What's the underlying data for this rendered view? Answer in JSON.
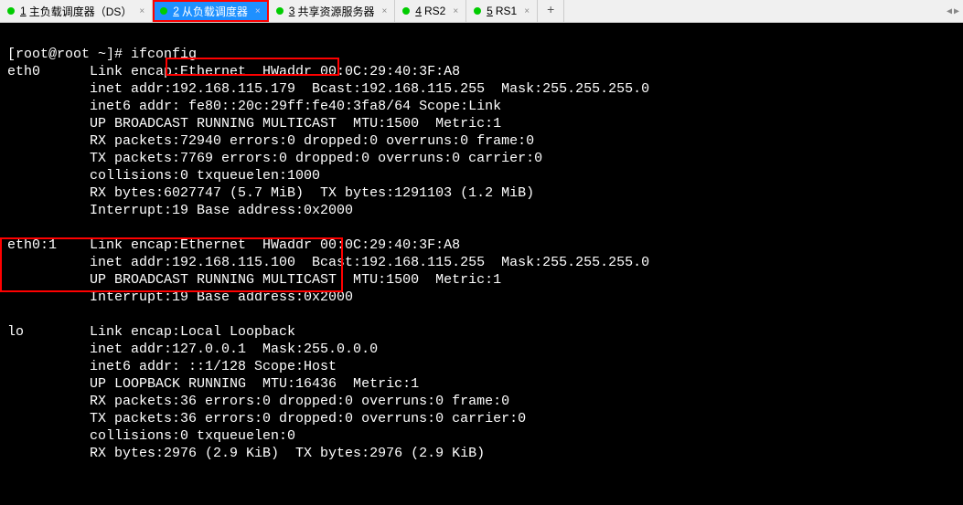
{
  "tabs": [
    {
      "num": "1",
      "label": "主负载调度器（DS）",
      "active": false
    },
    {
      "num": "2",
      "label": "从负载调度器",
      "active": true,
      "highlighted": true
    },
    {
      "num": "3",
      "label": "共享资源服务器",
      "active": false
    },
    {
      "num": "4",
      "label": "RS2",
      "active": false
    },
    {
      "num": "5",
      "label": "RS1",
      "active": false
    }
  ],
  "add_label": "+",
  "terminal": {
    "prompt": "[root@root ~]# ifconfig",
    "eth0": [
      "eth0      Link encap:Ethernet  HWaddr 00:0C:29:40:3F:A8  ",
      "          inet addr:192.168.115.179  Bcast:192.168.115.255  Mask:255.255.255.0",
      "          inet6 addr: fe80::20c:29ff:fe40:3fa8/64 Scope:Link",
      "          UP BROADCAST RUNNING MULTICAST  MTU:1500  Metric:1",
      "          RX packets:72940 errors:0 dropped:0 overruns:0 frame:0",
      "          TX packets:7769 errors:0 dropped:0 overruns:0 carrier:0",
      "          collisions:0 txqueuelen:1000 ",
      "          RX bytes:6027747 (5.7 MiB)  TX bytes:1291103 (1.2 MiB)",
      "          Interrupt:19 Base address:0x2000 "
    ],
    "eth01": [
      "eth0:1    Link encap:Ethernet  HWaddr 00:0C:29:40:3F:A8  ",
      "          inet addr:192.168.115.100  Bcast:192.168.115.255  Mask:255.255.255.0",
      "          UP BROADCAST RUNNING MULTICAST  MTU:1500  Metric:1",
      "          Interrupt:19 Base address:0x2000 "
    ],
    "lo": [
      "lo        Link encap:Local Loopback  ",
      "          inet addr:127.0.0.1  Mask:255.0.0.0",
      "          inet6 addr: ::1/128 Scope:Host",
      "          UP LOOPBACK RUNNING  MTU:16436  Metric:1",
      "          RX packets:36 errors:0 dropped:0 overruns:0 frame:0",
      "          TX packets:36 errors:0 dropped:0 overruns:0 carrier:0",
      "          collisions:0 txqueuelen:0 ",
      "          RX bytes:2976 (2.9 KiB)  TX bytes:2976 (2.9 KiB)"
    ]
  },
  "annotations": {
    "color": "#ff0000"
  }
}
